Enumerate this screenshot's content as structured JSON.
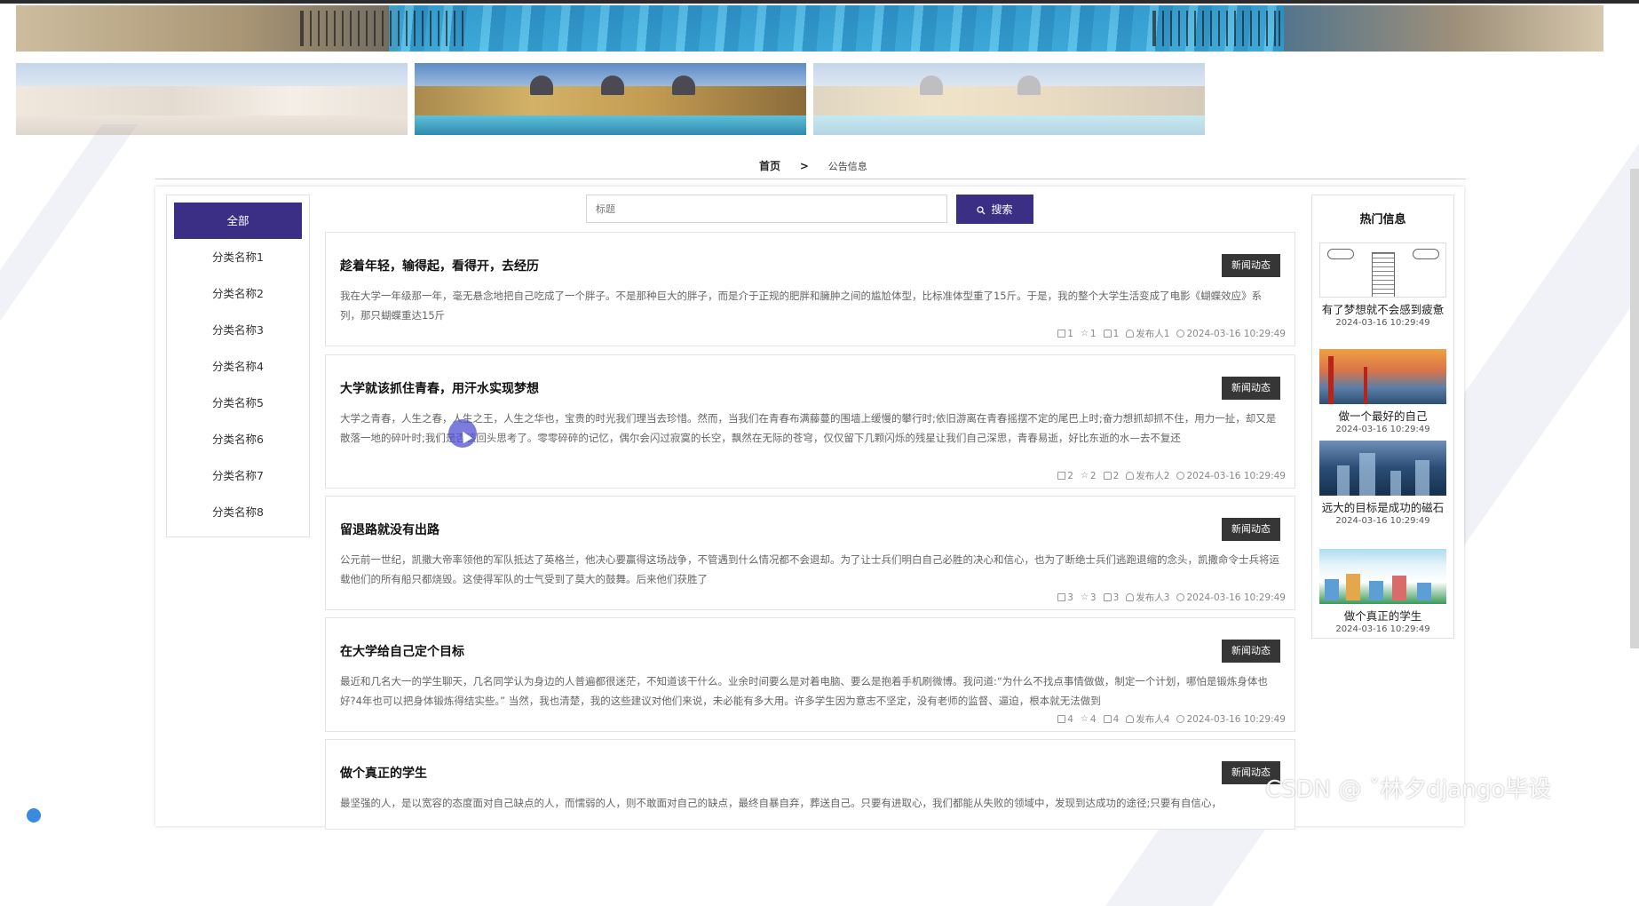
{
  "breadcrumb": {
    "home": "首页",
    "separator": ">",
    "current": "公告信息"
  },
  "search": {
    "placeholder": "标题",
    "button_label": "搜索",
    "button_icon": "search-icon"
  },
  "categories": {
    "items": [
      "全部",
      "分类名称1",
      "分类名称2",
      "分类名称3",
      "分类名称4",
      "分类名称5",
      "分类名称6",
      "分类名称7",
      "分类名称8"
    ],
    "active_index": 0
  },
  "news": [
    {
      "title": "趁着年轻，输得起，看得开，去经历",
      "tag": "新闻动态",
      "desc": "我在大学一年级那一年，毫无悬念地把自己吃成了一个胖子。不是那种巨大的胖子，而是介于正规的肥胖和臃肿之间的尴尬体型，比标准体型重了15斤。于是，我的整个大学生活变成了电影《蝴蝶效应》系列，那只蝴蝶重达15斤",
      "comments": "1",
      "stars": "1",
      "likes": "1",
      "author": "发布人1",
      "time": "2024-03-16 10:29:49"
    },
    {
      "title": "大学就该抓住青春，用汗水实现梦想",
      "tag": "新闻动态",
      "desc": "大学之青春，人生之春，人生之王，人生之华也，宝贵的时光我们理当去珍惜。然而，当我们在青春布满藤蔓的围墙上缓慢的攀行时;依旧游离在青春摇摆不定的尾巴上时;奋力想抓却抓不住，用力一扯，却又是散落一地的碎叶时;我们是否该回头思考了。零零碎碎的记忆，偶尔会闪过寂寞的长空，飘然在无际的苍穹，仅仅留下几颗闪烁的残星让我们自己深思，青春易逝，好比东逝的水—去不复还",
      "comments": "2",
      "stars": "2",
      "likes": "2",
      "author": "发布人2",
      "time": "2024-03-16 10:29:49"
    },
    {
      "title": "留退路就没有出路",
      "tag": "新闻动态",
      "desc": "公元前一世纪，凯撒大帝率领他的军队抵达了英格兰，他决心要赢得这场战争，不管遇到什么情况都不会退却。为了让士兵们明白自己必胜的决心和信心，也为了断绝士兵们逃跑退缩的念头，凯撒命令士兵将运载他们的所有船只都烧毁。这使得军队的士气受到了莫大的鼓舞。后来他们获胜了",
      "comments": "3",
      "stars": "3",
      "likes": "3",
      "author": "发布人3",
      "time": "2024-03-16 10:29:49"
    },
    {
      "title": "在大学给自己定个目标",
      "tag": "新闻动态",
      "desc": "最近和几名大一的学生聊天，几名同学认为身边的人普遍都很迷茫，不知道该干什么。业余时间要么是对着电脑、要么是抱着手机刷微博。我问道:“为什么不找点事情做做，制定一个计划，哪怕是锻炼身体也好?4年也可以把身体锻炼得结实些。” 当然，我也清楚，我的这些建议对他们来说，未必能有多大用。许多学生因为意志不坚定，没有老师的监督、逼迫，根本就无法做到",
      "comments": "4",
      "stars": "4",
      "likes": "4",
      "author": "发布人4",
      "time": "2024-03-16 10:29:49"
    },
    {
      "title": "做个真正的学生",
      "tag": "新闻动态",
      "desc": "最坚强的人，是以宽容的态度面对自己缺点的人，而懦弱的人，则不敢面对自己的缺点，最终自暴自弃，葬送自己。只要有进取心，我们都能从失败的领域中，发现到达成功的途径;只要有自信心，",
      "comments": "",
      "stars": "",
      "likes": "",
      "author": "",
      "time": ""
    }
  ],
  "hot": {
    "title": "热门信息",
    "items": [
      {
        "name": "有了梦想就不会感到疲惫",
        "date": "2024-03-16 10:29:49"
      },
      {
        "name": "做一个最好的自己",
        "date": "2024-03-16 10:29:49"
      },
      {
        "name": "远大的目标是成功的磁石",
        "date": "2024-03-16 10:29:49"
      },
      {
        "name": "做个真正的学生",
        "date": "2024-03-16 10:29:49"
      }
    ]
  },
  "watermark": "CSDN @ ˇ林夕django毕设",
  "colors": {
    "primary": "#3a2e85",
    "tag": "#363636"
  }
}
